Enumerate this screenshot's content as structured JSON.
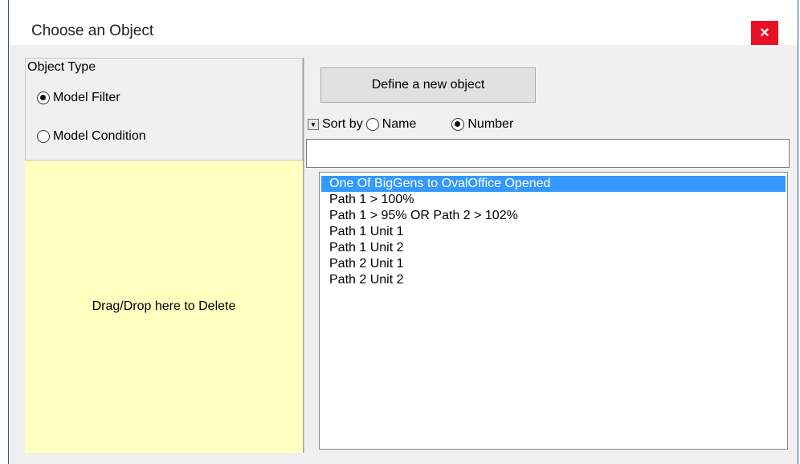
{
  "window": {
    "title": "Choose an Object",
    "close_icon": "×"
  },
  "object_type": {
    "legend": "Object Type",
    "options": [
      {
        "label": "Model Filter",
        "checked": true
      },
      {
        "label": "Model Condition",
        "checked": false
      }
    ]
  },
  "drop_zone": {
    "label": "Drag/Drop here to Delete"
  },
  "toolbar": {
    "define_label": "Define a new object"
  },
  "sort": {
    "dropdown_icon": "▼",
    "label": "Sort by",
    "options": [
      {
        "label": "Name",
        "checked": false
      },
      {
        "label": "Number",
        "checked": true
      }
    ]
  },
  "search": {
    "value": ""
  },
  "objects": {
    "selected_index": 0,
    "items": [
      "One Of BigGens to OvalOffice Opened",
      "Path 1 > 100%",
      "Path 1 > 95% OR Path 2 > 102%",
      "Path 1 Unit 1",
      "Path 1 Unit 2",
      "Path 2 Unit 1",
      "Path 2 Unit 2"
    ]
  },
  "colors": {
    "drop_zone_bg": "#ffffc0",
    "selection_bg": "#3399ff",
    "close_bg": "#e81123"
  }
}
